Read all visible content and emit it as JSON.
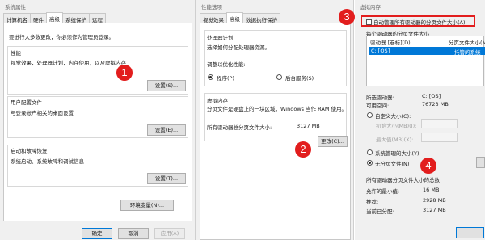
{
  "win1": {
    "title": "系统属性",
    "tabs": [
      "计算机名",
      "硬件",
      "高级",
      "系统保护",
      "远程"
    ],
    "intro": "要进行大多数更改，你必须作为管理员登录。",
    "performance": {
      "title": "性能",
      "desc": "视觉效果，处理器计划，内存使用，以及虚拟内存",
      "button": "设置(S)..."
    },
    "profile": {
      "title": "用户配置文件",
      "desc": "与登录帐户相关的桌面设置",
      "button": "设置(E)..."
    },
    "startup": {
      "title": "启动和故障恢复",
      "desc": "系统启动、系统故障和调试信息",
      "button": "设置(T)..."
    },
    "env_button": "环境变量(N)...",
    "ok": "确定",
    "cancel": "取消",
    "apply": "应用(A)"
  },
  "win2": {
    "title": "性能选项",
    "tabs": [
      "视觉效果",
      "高级",
      "数据执行保护"
    ],
    "cpu": {
      "title": "处理器计划",
      "desc": "选择如何分配处理器资源。",
      "optimize": "调整以优化性能:",
      "programs": "程序(P)",
      "background": "后台服务(S)"
    },
    "vm": {
      "title": "虚拟内存",
      "desc": "分页文件是硬盘上的一块区域，Windows 当作 RAM 使用。",
      "total_label": "所有驱动器总分页文件大小:",
      "total_value": "3127 MB",
      "button": "更改(C)..."
    }
  },
  "win3": {
    "title": "虚拟内存",
    "auto_checkbox": "自动管理所有驱动器的分页文件大小(A)",
    "per_drive": "每个驱动器的分页文件大小",
    "col_drive": "驱动器 [卷标](D)",
    "col_size": "分页文件大小(MB)",
    "row_drive": "C:      [OS]",
    "row_size": "托管的系统",
    "selected_drive_label": "所选驱动器:",
    "selected_drive_value": "C:  [OS]",
    "space_label": "可用空间:",
    "space_value": "76723 MB",
    "custom": "自定义大小(C):",
    "initial": "初始大小(MB)(I):",
    "max": "最大值(MB)(X):",
    "system_managed": "系统管理的大小(Y)",
    "no_paging": "无分页文件(N)",
    "total_title": "所有驱动器分页文件大小的总数",
    "min_label": "允许的最小值:",
    "min_value": "16 MB",
    "rec_label": "推荐:",
    "rec_value": "2928 MB",
    "cur_label": "当前已分配:",
    "cur_value": "3127 MB"
  },
  "badges": [
    "1",
    "2",
    "3",
    "4"
  ],
  "colors": {
    "accent": "#e21d1d",
    "selection": "#0078d7"
  }
}
